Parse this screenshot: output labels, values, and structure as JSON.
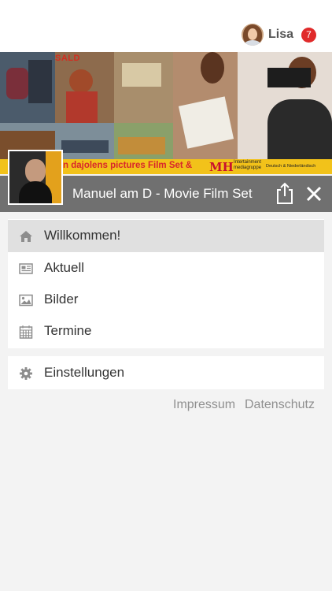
{
  "user": {
    "name": "Lisa",
    "notification_count": "7"
  },
  "banner": {
    "title_text": "SALD",
    "subtitle_text": "",
    "strip_text": "n dajolens pictures Film Set &",
    "logo_text": "MH",
    "logo_small": "Intertainment\nmediagruppe",
    "strip_right": "Deutsch & Niederländisch"
  },
  "page": {
    "title": "Manuel am D - Movie Film Set"
  },
  "menu": {
    "items": [
      {
        "label": "Willkommen!",
        "icon": "home-icon"
      },
      {
        "label": "Aktuell",
        "icon": "newspaper-icon"
      },
      {
        "label": "Bilder",
        "icon": "image-icon"
      },
      {
        "label": "Termine",
        "icon": "calendar-icon"
      }
    ],
    "settings": {
      "label": "Einstellungen",
      "icon": "gear-icon"
    }
  },
  "footer": {
    "impressum": "Impressum",
    "datenschutz": "Datenschutz"
  },
  "colors": {
    "accent_badge": "#e02a2a",
    "bar": "#707070",
    "strip": "#f2c21a"
  }
}
